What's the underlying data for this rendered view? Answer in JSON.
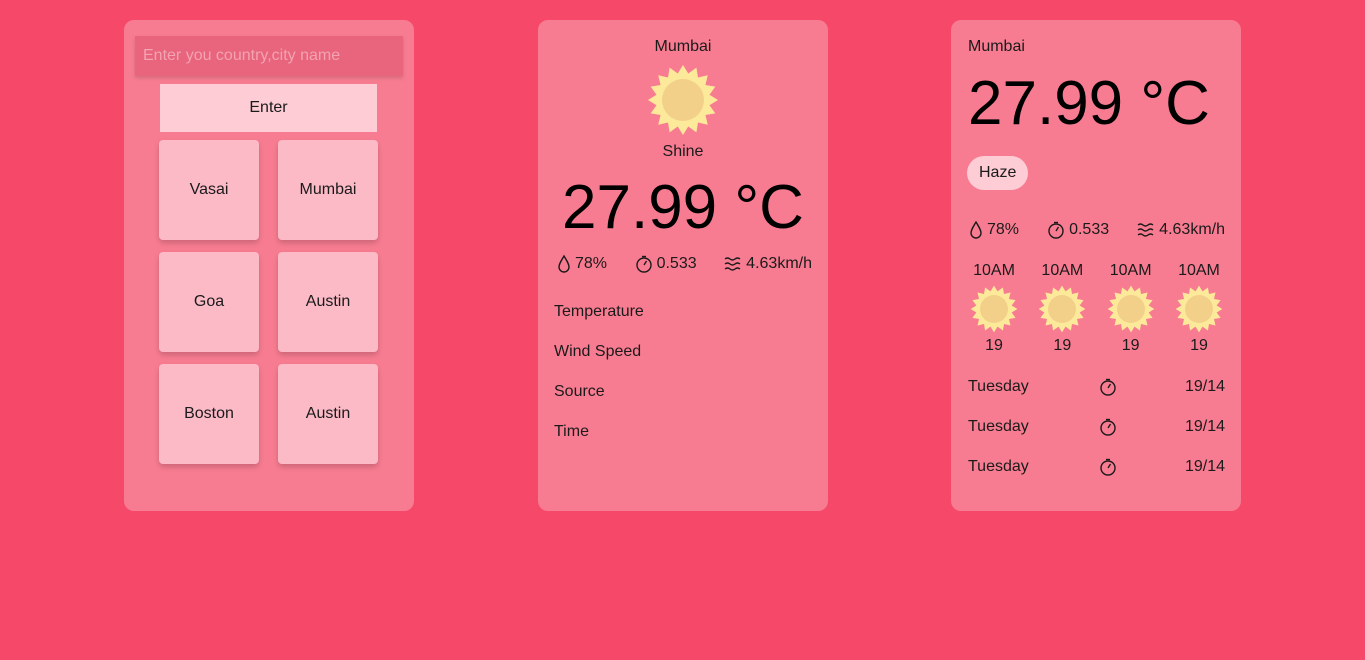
{
  "search": {
    "placeholder": "Enter you country,city name",
    "enter_label": "Enter",
    "cities": [
      "Vasai",
      "Mumbai",
      "Goa",
      "Austin",
      "Boston",
      "Austin"
    ]
  },
  "current": {
    "city": "Mumbai",
    "weather_icon": "sun-icon",
    "condition": "Shine",
    "temperature": "27.99 °C",
    "humidity": "78%",
    "pressure": "0.533",
    "wind": "4.63km/h",
    "details": [
      "Temperature",
      "Wind Speed",
      "Source",
      "Time"
    ]
  },
  "detail": {
    "city": "Mumbai",
    "temperature": "27.99 °C",
    "condition": "Haze",
    "humidity": "78%",
    "pressure": "0.533",
    "wind": "4.63km/h",
    "hourly": [
      {
        "time": "10AM",
        "value": "19"
      },
      {
        "time": "10AM",
        "value": "19"
      },
      {
        "time": "10AM",
        "value": "19"
      },
      {
        "time": "10AM",
        "value": "19"
      }
    ],
    "daily": [
      {
        "day": "Tuesday",
        "date": "19/14"
      },
      {
        "day": "Tuesday",
        "date": "19/14"
      },
      {
        "day": "Tuesday",
        "date": "19/14"
      }
    ]
  },
  "colors": {
    "background": "#f64869",
    "card": "#f87c91",
    "tile": "#fcbac7",
    "button": "#fdccd5",
    "sun_body": "#f3d08a",
    "sun_rays": "#fde99a"
  }
}
